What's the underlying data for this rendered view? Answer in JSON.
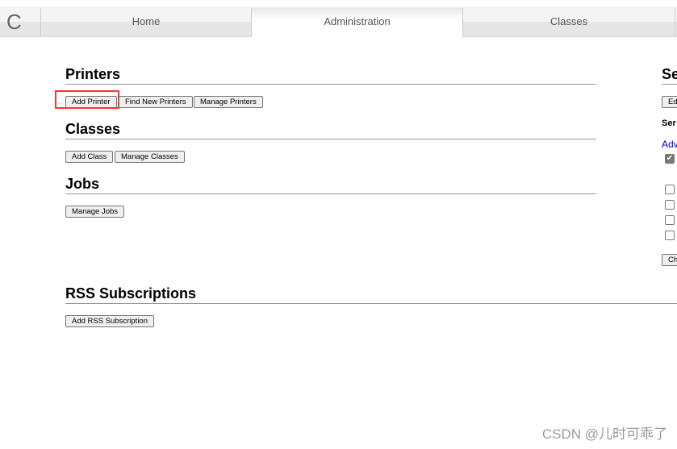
{
  "nav": {
    "logo": "C",
    "tabs": [
      {
        "label": "Home"
      },
      {
        "label": "Administration",
        "active": true
      },
      {
        "label": "Classes"
      }
    ]
  },
  "printers": {
    "title": "Printers",
    "add": "Add Printer",
    "find": "Find New Printers",
    "manage": "Manage Printers"
  },
  "classes": {
    "title": "Classes",
    "add": "Add Class",
    "manage": "Manage Classes"
  },
  "jobs": {
    "title": "Jobs",
    "manage": "Manage Jobs"
  },
  "rss": {
    "title": "RSS Subscriptions",
    "add": "Add RSS Subscription"
  },
  "server": {
    "title": "Se",
    "edit": "Ed",
    "settings": "Ser",
    "advanced": "Adv",
    "change": "Ch",
    "checkboxes": [
      true,
      false,
      false,
      false,
      false
    ]
  },
  "watermark": "CSDN @儿时可乖了"
}
